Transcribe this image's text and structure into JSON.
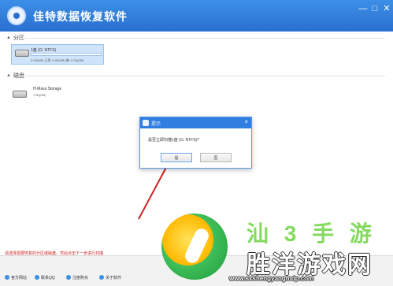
{
  "window": {
    "title": "佳特数据恢复软件",
    "controls": [
      "—",
      "□",
      "✕"
    ]
  },
  "sections": {
    "partitions": {
      "label": "分区",
      "selected_drive": {
        "name": "1盘 (G: NTFS)",
        "stats": "0.00(GB) 已用: 0.00(GB) 剩: 0.00(GB)"
      }
    },
    "disks": {
      "label": "磁盘",
      "drive": {
        "name": "H-Mass Storage",
        "stats": "7.50(GB)"
      }
    }
  },
  "dialog": {
    "title": "提示",
    "message": "是否立即扫描1盘 (G: NTFS)?",
    "buttons": {
      "yes": "是",
      "no": "否"
    }
  },
  "footer": {
    "message": "请选择需要恢复的分区或磁盘，然后点击下一步进行扫描",
    "items": [
      "官方网站",
      "联系QQ",
      "注册购买",
      "关于软件"
    ]
  },
  "watermark": {
    "top": "汕 3 手 游",
    "main": "胜洋游戏网",
    "url": "www.sxshengyangmdp.com"
  }
}
